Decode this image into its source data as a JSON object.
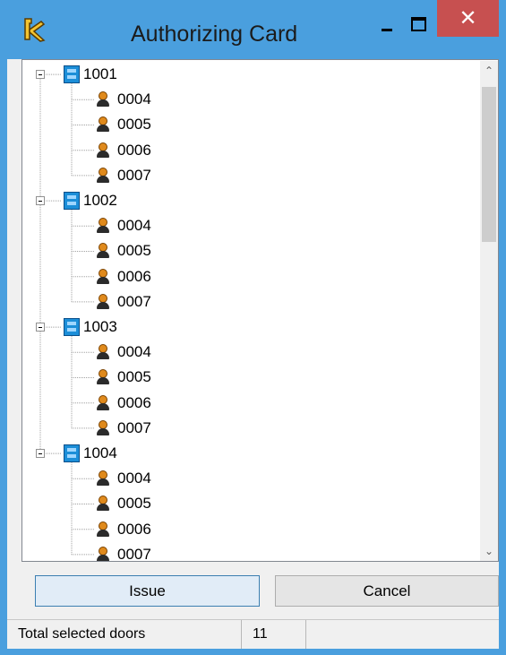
{
  "window": {
    "title": "Authorizing Card",
    "close_glyph": "✕",
    "colors": {
      "title_bar": "#4a9fde",
      "close_button": "#c75050"
    }
  },
  "tree": {
    "groups": [
      {
        "label": "1001",
        "expanded": true,
        "children": [
          "0004",
          "0005",
          "0006",
          "0007"
        ]
      },
      {
        "label": "1002",
        "expanded": true,
        "children": [
          "0004",
          "0005",
          "0006",
          "0007"
        ]
      },
      {
        "label": "1003",
        "expanded": true,
        "children": [
          "0004",
          "0005",
          "0006",
          "0007"
        ]
      },
      {
        "label": "1004",
        "expanded": true,
        "children": [
          "0004",
          "0005",
          "0006",
          "0007"
        ]
      }
    ],
    "group_icon": "door-icon",
    "child_icon": "user-icon",
    "scroll_up_glyph": "⌃",
    "scroll_down_glyph": "⌄"
  },
  "buttons": {
    "issue_label": "Issue",
    "cancel_label": "Cancel"
  },
  "status": {
    "label": "Total selected doors",
    "value": "11"
  }
}
